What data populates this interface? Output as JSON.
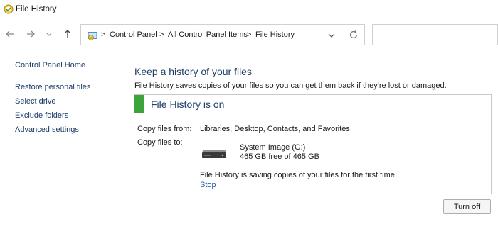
{
  "window": {
    "title": "File History"
  },
  "breadcrumb": {
    "items": [
      "Control Panel",
      "All Control Panel Items",
      "File History"
    ]
  },
  "sidebar": {
    "home": "Control Panel Home",
    "items": [
      {
        "label": "Restore personal files"
      },
      {
        "label": "Select drive"
      },
      {
        "label": "Exclude folders"
      },
      {
        "label": "Advanced settings"
      }
    ]
  },
  "main": {
    "heading": "Keep a history of your files",
    "description": "File History saves copies of your files so you can get them back if they're lost or damaged.",
    "status": "File History is on",
    "copy_from_label": "Copy files from:",
    "copy_from_value": "Libraries, Desktop, Contacts, and Favorites",
    "copy_to_label": "Copy files to:",
    "drive_name": "System Image (G:)",
    "drive_space": "465 GB free of 465 GB",
    "progress_message": "File History is saving copies of your files for the first time.",
    "stop_label": "Stop"
  },
  "actions": {
    "turn_off_label": "Turn off"
  },
  "colors": {
    "status_accent": "#3da33d",
    "heading": "#1e3f66",
    "link": "#1a5aa6"
  },
  "icons": {
    "app": "file-history-icon",
    "back": "back-arrow-icon",
    "forward": "forward-arrow-icon",
    "recent": "chevron-down-icon",
    "up": "up-arrow-icon",
    "control_panel": "control-panel-icon",
    "address_dropdown": "chevron-down-icon",
    "refresh": "refresh-icon",
    "drive": "hard-drive-icon"
  }
}
